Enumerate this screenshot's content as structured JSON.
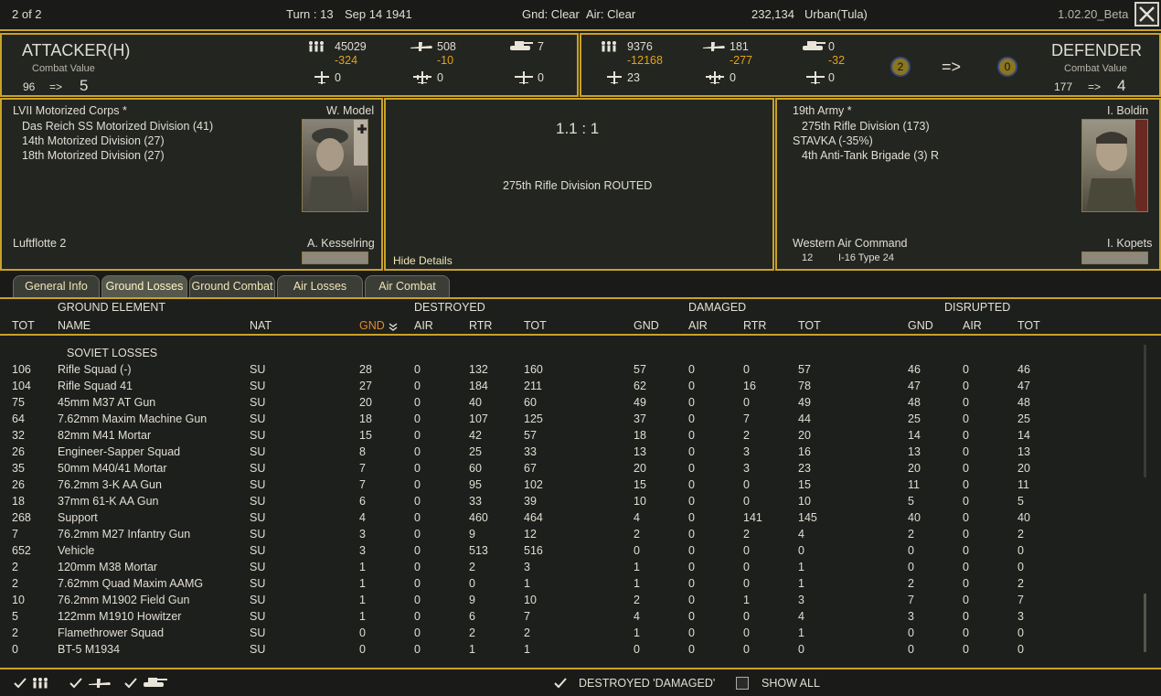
{
  "topbar": {
    "page": "2 of 2",
    "turn": "Turn : 13",
    "date": "Sep 14 1941",
    "gnd": "Gnd: Clear",
    "air": "Air: Clear",
    "hex": "232,134",
    "terrain": "Urban(Tula)",
    "version": "1.02.20_Beta"
  },
  "attacker": {
    "title": "ATTACKER(H)",
    "cv_label": "Combat Value",
    "cv_before": "96",
    "arrow": "=>",
    "cv_after": "5",
    "men": "45029",
    "men_loss": "-324",
    "planes": "508",
    "planes_loss": "-10",
    "tanks": "7",
    "fighters": "0",
    "bombers": "0",
    "transports": "0",
    "hq": "LVII Motorized Corps *",
    "leader": "W. Model",
    "units": [
      "Das Reich SS Motorized Division (41)",
      "14th Motorized Division (27)",
      "18th Motorized Division (27)"
    ],
    "air_hq": "Luftflotte 2",
    "air_leader": "A. Kesselring"
  },
  "defender": {
    "title": "DEFENDER",
    "cv_label": "Combat Value",
    "cv_before": "177",
    "arrow": "=>",
    "cv_after": "4",
    "men": "9376",
    "men_loss": "-12168",
    "planes": "181",
    "planes_loss": "-277",
    "tanks": "0",
    "tanks_loss": "-32",
    "fighters": "23",
    "bombers": "0",
    "transports": "0",
    "hq": "19th Army *",
    "leader": "I. Boldin",
    "units": [
      "275th Rifle Division (173)",
      "STAVKA (-35%)",
      "4th Anti-Tank Brigade (3)  R"
    ],
    "air_hq": "Western Air Command",
    "air_leader": "I. Kopets",
    "air_count": "12",
    "air_type": "I-16 Type 24"
  },
  "middle": {
    "fort_left": "2",
    "fort_arrow": "=>",
    "fort_right": "0",
    "odds": "1.1 : 1",
    "result": "275th Rifle Division ROUTED",
    "hide": "Hide Details"
  },
  "tabs": [
    "General Info",
    "Ground Losses",
    "Ground Combat",
    "Air Losses",
    "Air Combat"
  ],
  "table": {
    "group_ground": "GROUND ELEMENT",
    "group_destroyed": "DESTROYED",
    "group_damaged": "DAMAGED",
    "group_disrupted": "DISRUPTED",
    "cols": [
      "TOT",
      "NAME",
      "NAT",
      "GND",
      "AIR",
      "RTR",
      "TOT",
      "GND",
      "AIR",
      "RTR",
      "TOT",
      "GND",
      "AIR",
      "TOT"
    ],
    "section": "SOVIET LOSSES",
    "rows": [
      [
        "106",
        "Rifle Squad (-)",
        "SU",
        "28",
        "0",
        "132",
        "160",
        "57",
        "0",
        "0",
        "57",
        "46",
        "0",
        "46"
      ],
      [
        "104",
        "Rifle Squad 41",
        "SU",
        "27",
        "0",
        "184",
        "211",
        "62",
        "0",
        "16",
        "78",
        "47",
        "0",
        "47"
      ],
      [
        "75",
        "45mm M37 AT Gun",
        "SU",
        "20",
        "0",
        "40",
        "60",
        "49",
        "0",
        "0",
        "49",
        "48",
        "0",
        "48"
      ],
      [
        "64",
        "7.62mm Maxim Machine Gun",
        "SU",
        "18",
        "0",
        "107",
        "125",
        "37",
        "0",
        "7",
        "44",
        "25",
        "0",
        "25"
      ],
      [
        "32",
        "82mm M41 Mortar",
        "SU",
        "15",
        "0",
        "42",
        "57",
        "18",
        "0",
        "2",
        "20",
        "14",
        "0",
        "14"
      ],
      [
        "26",
        "Engineer-Sapper Squad",
        "SU",
        "8",
        "0",
        "25",
        "33",
        "13",
        "0",
        "3",
        "16",
        "13",
        "0",
        "13"
      ],
      [
        "35",
        "50mm M40/41 Mortar",
        "SU",
        "7",
        "0",
        "60",
        "67",
        "20",
        "0",
        "3",
        "23",
        "20",
        "0",
        "20"
      ],
      [
        "26",
        "76.2mm 3-K AA Gun",
        "SU",
        "7",
        "0",
        "95",
        "102",
        "15",
        "0",
        "0",
        "15",
        "11",
        "0",
        "11"
      ],
      [
        "18",
        "37mm 61-K AA Gun",
        "SU",
        "6",
        "0",
        "33",
        "39",
        "10",
        "0",
        "0",
        "10",
        "5",
        "0",
        "5"
      ],
      [
        "268",
        "Support",
        "SU",
        "4",
        "0",
        "460",
        "464",
        "4",
        "0",
        "141",
        "145",
        "40",
        "0",
        "40"
      ],
      [
        "7",
        "76.2mm M27 Infantry Gun",
        "SU",
        "3",
        "0",
        "9",
        "12",
        "2",
        "0",
        "2",
        "4",
        "2",
        "0",
        "2"
      ],
      [
        "652",
        "Vehicle",
        "SU",
        "3",
        "0",
        "513",
        "516",
        "0",
        "0",
        "0",
        "0",
        "0",
        "0",
        "0"
      ],
      [
        "2",
        "120mm M38 Mortar",
        "SU",
        "1",
        "0",
        "2",
        "3",
        "1",
        "0",
        "0",
        "1",
        "0",
        "0",
        "0"
      ],
      [
        "2",
        "7.62mm Quad Maxim AAMG",
        "SU",
        "1",
        "0",
        "0",
        "1",
        "1",
        "0",
        "0",
        "1",
        "2",
        "0",
        "2"
      ],
      [
        "10",
        "76.2mm M1902 Field Gun",
        "SU",
        "1",
        "0",
        "9",
        "10",
        "2",
        "0",
        "1",
        "3",
        "7",
        "0",
        "7"
      ],
      [
        "5",
        "122mm M1910 Howitzer",
        "SU",
        "1",
        "0",
        "6",
        "7",
        "4",
        "0",
        "0",
        "4",
        "3",
        "0",
        "3"
      ],
      [
        "2",
        "Flamethrower Squad",
        "SU",
        "0",
        "0",
        "2",
        "2",
        "1",
        "0",
        "0",
        "1",
        "0",
        "0",
        "0"
      ],
      [
        "0",
        "BT-5 M1934",
        "SU",
        "0",
        "0",
        "1",
        "1",
        "0",
        "0",
        "0",
        "0",
        "0",
        "0",
        "0"
      ]
    ]
  },
  "bottom": {
    "destroyed_damaged": "DESTROYED 'DAMAGED'",
    "show_all": "SHOW ALL"
  },
  "colors": {
    "accent": "#c9a227",
    "loss": "#e6a316",
    "sort": "#e08a2e"
  }
}
